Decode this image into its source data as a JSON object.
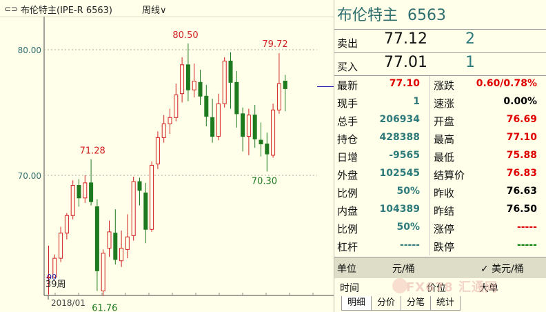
{
  "header": {
    "link_icon": "⊂⊃",
    "title": "布伦特主(IPE-R 6563)",
    "period_label": "周线∨"
  },
  "chart_data": {
    "type": "candlestick",
    "yaxis_ticks": [
      "80.00",
      "70.00"
    ],
    "x_label": "2018/01",
    "annotations": {
      "high1": "71.28",
      "low1": "61.76",
      "high2": "80.50",
      "high3": "79.72",
      "low2": "70.30",
      "weeks_label": "39周",
      "weeks_overlay": "00"
    },
    "candles": [
      {
        "o": 61.9,
        "c": 61.9,
        "h": 64.4,
        "l": 60.5
      },
      {
        "o": 61.9,
        "c": 63.4,
        "h": 63.7,
        "l": 61.8
      },
      {
        "o": 63.4,
        "c": 65.4,
        "h": 65.9,
        "l": 63.1
      },
      {
        "o": 65.4,
        "c": 66.8,
        "h": 67.0,
        "l": 64.9
      },
      {
        "o": 66.8,
        "c": 69.2,
        "h": 69.6,
        "l": 66.5
      },
      {
        "o": 69.2,
        "c": 68.2,
        "h": 69.7,
        "l": 67.5
      },
      {
        "o": 68.2,
        "c": 69.4,
        "h": 70.0,
        "l": 67.8
      },
      {
        "o": 69.4,
        "c": 67.9,
        "h": 71.28,
        "l": 67.6
      },
      {
        "o": 67.5,
        "c": 62.4,
        "h": 68.1,
        "l": 60.8
      },
      {
        "o": 60.8,
        "c": 63.8,
        "h": 64.1,
        "l": 60.4
      },
      {
        "o": 64.2,
        "c": 65.5,
        "h": 66.4,
        "l": 63.5
      },
      {
        "o": 65.4,
        "c": 63.3,
        "h": 67.3,
        "l": 62.9
      },
      {
        "o": 63.2,
        "c": 64.2,
        "h": 65.6,
        "l": 62.7
      },
      {
        "o": 64.1,
        "c": 65.1,
        "h": 66.9,
        "l": 63.4
      },
      {
        "o": 65.2,
        "c": 69.5,
        "h": 69.9,
        "l": 64.8
      },
      {
        "o": 69.5,
        "c": 68.8,
        "h": 69.8,
        "l": 67.6
      },
      {
        "o": 68.6,
        "c": 65.7,
        "h": 69.4,
        "l": 64.6
      },
      {
        "o": 65.7,
        "c": 70.8,
        "h": 71.1,
        "l": 65.5
      },
      {
        "o": 70.9,
        "c": 73.0,
        "h": 73.5,
        "l": 70.5
      },
      {
        "o": 73.0,
        "c": 74.1,
        "h": 74.8,
        "l": 72.6
      },
      {
        "o": 74.1,
        "c": 74.6,
        "h": 75.3,
        "l": 73.3
      },
      {
        "o": 74.6,
        "c": 76.4,
        "h": 77.3,
        "l": 74.3
      },
      {
        "o": 76.5,
        "c": 78.8,
        "h": 79.4,
        "l": 75.8
      },
      {
        "o": 78.8,
        "c": 76.8,
        "h": 80.5,
        "l": 75.9
      },
      {
        "o": 76.8,
        "c": 77.5,
        "h": 78.9,
        "l": 76.2
      },
      {
        "o": 77.4,
        "c": 76.3,
        "h": 78.4,
        "l": 75.6
      },
      {
        "o": 76.3,
        "c": 74.7,
        "h": 77.2,
        "l": 73.9
      },
      {
        "o": 74.6,
        "c": 73.1,
        "h": 76.1,
        "l": 72.6
      },
      {
        "o": 73.1,
        "c": 75.7,
        "h": 76.5,
        "l": 72.8
      },
      {
        "o": 75.7,
        "c": 79.1,
        "h": 79.4,
        "l": 75.4
      },
      {
        "o": 79.1,
        "c": 77.4,
        "h": 79.8,
        "l": 75.3
      },
      {
        "o": 77.4,
        "c": 74.9,
        "h": 78.3,
        "l": 73.8
      },
      {
        "o": 74.9,
        "c": 73.1,
        "h": 75.4,
        "l": 71.9
      },
      {
        "o": 73.1,
        "c": 74.8,
        "h": 75.3,
        "l": 71.6
      },
      {
        "o": 74.8,
        "c": 72.9,
        "h": 75.6,
        "l": 72.2
      },
      {
        "o": 72.8,
        "c": 72.5,
        "h": 74.2,
        "l": 71.5
      },
      {
        "o": 72.5,
        "c": 71.7,
        "h": 73.4,
        "l": 70.3
      },
      {
        "o": 71.6,
        "c": 75.2,
        "h": 75.7,
        "l": 71.4
      },
      {
        "o": 75.2,
        "c": 77.3,
        "h": 79.72,
        "l": 74.9
      },
      {
        "o": 77.5,
        "c": 76.9,
        "h": 78.0,
        "l": 75.1
      }
    ]
  },
  "panel": {
    "name": "布伦特主",
    "code": "6563",
    "sell_label": "卖出",
    "sell_price": "77.12",
    "sell_vol": "2",
    "buy_label": "买入",
    "buy_price": "77.01",
    "buy_vol": "1",
    "rows": [
      {
        "l": "最新",
        "lv": "77.10",
        "lc": "red",
        "r": "涨跌",
        "rv": "0.60/0.78%",
        "rc": "red"
      },
      {
        "l": "现手",
        "lv": "1",
        "lc": "teal",
        "r": "速涨",
        "rv": "0.00%",
        "rc": "blk"
      },
      {
        "l": "总手",
        "lv": "206934",
        "lc": "teal",
        "r": "开盘",
        "rv": "76.69",
        "rc": "red"
      },
      {
        "l": "持仓",
        "lv": "428388",
        "lc": "teal",
        "r": "最高",
        "rv": "77.10",
        "rc": "red"
      },
      {
        "l": "日增",
        "lv": "-9565",
        "lc": "teal",
        "r": "最低",
        "rv": "75.88",
        "rc": "red"
      },
      {
        "l": "外盘",
        "lv": "102545",
        "lc": "teal",
        "r": "结算价",
        "rv": "76.83",
        "rc": "red"
      },
      {
        "l": "比例",
        "lv": "50%",
        "lc": "teal",
        "r": "昨收",
        "rv": "76.63",
        "rc": "blk"
      },
      {
        "l": "内盘",
        "lv": "104389",
        "lc": "teal",
        "r": "昨结",
        "rv": "76.50",
        "rc": "blk"
      },
      {
        "l": "比例",
        "lv": "50%",
        "lc": "teal",
        "r": "涨停",
        "rv": "-----",
        "rc": "red"
      },
      {
        "l": "杠杆",
        "lv": "-----",
        "lc": "teal",
        "r": "跌停",
        "rv": "-----",
        "rc": "grn"
      }
    ],
    "unit_label": "单位",
    "unit_value": "元/桶",
    "unit_option": "✓ 美元/桶",
    "tick_time": "时间",
    "tick_price": "价位",
    "tick_big": "大单",
    "watermark": "FX678 汇通网",
    "tabs": [
      "明细",
      "分价",
      "分笔",
      "统计"
    ]
  },
  "colors": {
    "up": "#d22020",
    "down": "#1e7a1e",
    "axis": "#2f6f6f"
  }
}
